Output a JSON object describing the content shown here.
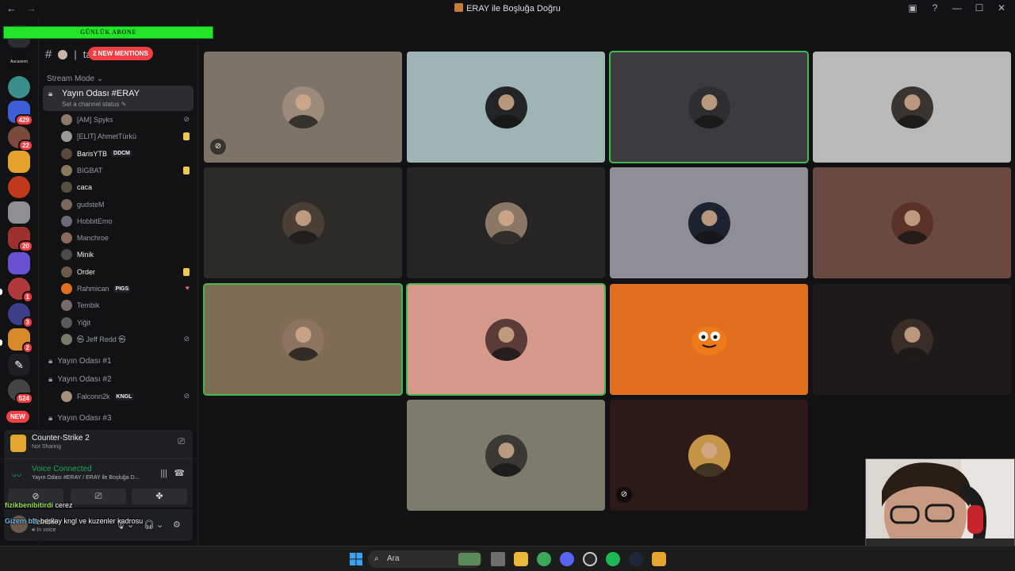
{
  "window": {
    "title": "ERAY ile Boşluğa Doğru",
    "nav_back": "←",
    "nav_fwd": "→",
    "controls": [
      "▣",
      "?",
      "—",
      "☐",
      "✕"
    ]
  },
  "rail": {
    "servers": [
      {
        "name": "Aucasiom",
        "badge": ""
      },
      {
        "name": "teal",
        "badge": ""
      },
      {
        "name": "blue",
        "badge": "429"
      },
      {
        "name": "girl",
        "badge": "22"
      },
      {
        "name": "face",
        "badge": ""
      },
      {
        "name": "red",
        "badge": ""
      },
      {
        "name": "T",
        "badge": ""
      },
      {
        "name": "card",
        "badge": "20"
      },
      {
        "name": "purple",
        "badge": ""
      },
      {
        "name": "redcap",
        "badge": "1"
      },
      {
        "name": "anime",
        "badge": "3"
      },
      {
        "name": "orange",
        "badge": "2"
      },
      {
        "name": "feather",
        "badge": ""
      },
      {
        "name": "dark",
        "badge": "524"
      }
    ],
    "new_label": "NEW"
  },
  "overlay": {
    "sub_banner": "GÜNLÜK ABONE",
    "mentions": "2 NEW MENTIONS"
  },
  "sidebar": {
    "header_text": "ta",
    "stream_mode": "Stream Mode",
    "active_channel": {
      "name": "Yayın Odası #ERAY",
      "status": "Set a channel status"
    },
    "members": [
      {
        "name": "[AM] Spyks",
        "tag": "",
        "bright": false,
        "icon": "mute"
      },
      {
        "name": "[ELIT] AhmetTürkü",
        "tag": "",
        "bright": false,
        "icon": "game"
      },
      {
        "name": "BarisYTB",
        "tag": "DDCM",
        "bright": true,
        "icon": ""
      },
      {
        "name": "BIGBAT",
        "tag": "",
        "bright": false,
        "icon": "game"
      },
      {
        "name": "caca",
        "tag": "",
        "bright": true,
        "icon": ""
      },
      {
        "name": "gudsteM",
        "tag": "",
        "bright": false,
        "icon": ""
      },
      {
        "name": "HobbitEmo",
        "tag": "",
        "bright": false,
        "icon": ""
      },
      {
        "name": "Manchroe",
        "tag": "",
        "bright": false,
        "icon": ""
      },
      {
        "name": "Minik",
        "tag": "",
        "bright": true,
        "icon": ""
      },
      {
        "name": "Order",
        "tag": "",
        "bright": true,
        "icon": "game"
      },
      {
        "name": "Rahmican",
        "tag": "PIGS",
        "bright": false,
        "icon": "heart"
      },
      {
        "name": "Tembik",
        "tag": "",
        "bright": false,
        "icon": ""
      },
      {
        "name": "Yiğit",
        "tag": "",
        "bright": false,
        "icon": ""
      },
      {
        "name": "㉿ Jeff Redd ㉿",
        "tag": "",
        "bright": false,
        "icon": "mute"
      }
    ],
    "voice_channels": [
      {
        "name": "Yayın Odası #1"
      },
      {
        "name": "Yayın Odası #2"
      },
      {
        "name": "Yayın Odası #3"
      }
    ],
    "sub_member": {
      "name": "Falconn2k",
      "tag": "KNGL"
    }
  },
  "game_panel": {
    "title": "Counter-Strike 2",
    "status": "Not Sharing"
  },
  "voice_panel": {
    "title": "Voice Connected",
    "channel": "Yayın Odası #ERAY / ERAY ile Boşluğa D..."
  },
  "user_panel": {
    "name": "Tembik",
    "status": "In voice"
  },
  "chat": [
    {
      "user": "fizikbenibitirdi",
      "text": "cerez"
    },
    {
      "user": "Gizem bis",
      "text": "berkay kngl ve kuzenler kadrosu"
    }
  ],
  "tiles": [
    {
      "bg": "#7d7366",
      "speaking": false,
      "muted": true,
      "avatar": "#9c8b7a"
    },
    {
      "bg": "#9fb4b4",
      "speaking": false,
      "muted": false,
      "avatar": "#222426"
    },
    {
      "bg": "#3b3c3f",
      "speaking": true,
      "muted": false,
      "avatar": "#2e2e30"
    },
    {
      "bg": "#b9b9b9",
      "speaking": false,
      "muted": false,
      "avatar": "#3a3430"
    },
    {
      "bg": "#2c2b28",
      "speaking": false,
      "muted": false,
      "avatar": "#4b3e35"
    },
    {
      "bg": "#262523",
      "speaking": false,
      "muted": false,
      "avatar": "#8a7766"
    },
    {
      "bg": "#8d8e96",
      "speaking": false,
      "muted": false,
      "avatar": "#1d2230"
    },
    {
      "bg": "#6a4a40",
      "speaking": false,
      "muted": false,
      "avatar": "#5a3228"
    },
    {
      "bg": "#7e6c55",
      "speaking": true,
      "muted": false,
      "avatar": "#8b7461"
    },
    {
      "bg": "#d59a8c",
      "speaking": true,
      "muted": false,
      "avatar": "#5b3b38"
    },
    {
      "bg": "#e07020",
      "speaking": false,
      "muted": false,
      "avatar": "#e07020"
    },
    {
      "bg": "#1e1a19",
      "speaking": false,
      "muted": false,
      "avatar": "#3a2c26"
    },
    {
      "bg": "#7c7b6c",
      "speaking": false,
      "muted": false,
      "avatar": "#3b3935"
    },
    {
      "bg": "#2c1a16",
      "speaking": false,
      "muted": true,
      "avatar": "#c69448"
    }
  ],
  "taskbar": {
    "search_label": "Ara"
  }
}
